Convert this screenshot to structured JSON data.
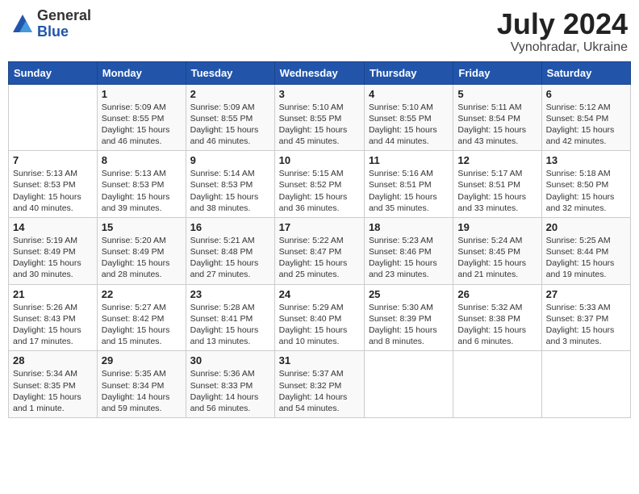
{
  "header": {
    "logo_general": "General",
    "logo_blue": "Blue",
    "month_year": "July 2024",
    "location": "Vynohradar, Ukraine"
  },
  "weekdays": [
    "Sunday",
    "Monday",
    "Tuesday",
    "Wednesday",
    "Thursday",
    "Friday",
    "Saturday"
  ],
  "weeks": [
    [
      {
        "day": "",
        "info": ""
      },
      {
        "day": "1",
        "info": "Sunrise: 5:09 AM\nSunset: 8:55 PM\nDaylight: 15 hours\nand 46 minutes."
      },
      {
        "day": "2",
        "info": "Sunrise: 5:09 AM\nSunset: 8:55 PM\nDaylight: 15 hours\nand 46 minutes."
      },
      {
        "day": "3",
        "info": "Sunrise: 5:10 AM\nSunset: 8:55 PM\nDaylight: 15 hours\nand 45 minutes."
      },
      {
        "day": "4",
        "info": "Sunrise: 5:10 AM\nSunset: 8:55 PM\nDaylight: 15 hours\nand 44 minutes."
      },
      {
        "day": "5",
        "info": "Sunrise: 5:11 AM\nSunset: 8:54 PM\nDaylight: 15 hours\nand 43 minutes."
      },
      {
        "day": "6",
        "info": "Sunrise: 5:12 AM\nSunset: 8:54 PM\nDaylight: 15 hours\nand 42 minutes."
      }
    ],
    [
      {
        "day": "7",
        "info": "Sunrise: 5:13 AM\nSunset: 8:53 PM\nDaylight: 15 hours\nand 40 minutes."
      },
      {
        "day": "8",
        "info": "Sunrise: 5:13 AM\nSunset: 8:53 PM\nDaylight: 15 hours\nand 39 minutes."
      },
      {
        "day": "9",
        "info": "Sunrise: 5:14 AM\nSunset: 8:53 PM\nDaylight: 15 hours\nand 38 minutes."
      },
      {
        "day": "10",
        "info": "Sunrise: 5:15 AM\nSunset: 8:52 PM\nDaylight: 15 hours\nand 36 minutes."
      },
      {
        "day": "11",
        "info": "Sunrise: 5:16 AM\nSunset: 8:51 PM\nDaylight: 15 hours\nand 35 minutes."
      },
      {
        "day": "12",
        "info": "Sunrise: 5:17 AM\nSunset: 8:51 PM\nDaylight: 15 hours\nand 33 minutes."
      },
      {
        "day": "13",
        "info": "Sunrise: 5:18 AM\nSunset: 8:50 PM\nDaylight: 15 hours\nand 32 minutes."
      }
    ],
    [
      {
        "day": "14",
        "info": "Sunrise: 5:19 AM\nSunset: 8:49 PM\nDaylight: 15 hours\nand 30 minutes."
      },
      {
        "day": "15",
        "info": "Sunrise: 5:20 AM\nSunset: 8:49 PM\nDaylight: 15 hours\nand 28 minutes."
      },
      {
        "day": "16",
        "info": "Sunrise: 5:21 AM\nSunset: 8:48 PM\nDaylight: 15 hours\nand 27 minutes."
      },
      {
        "day": "17",
        "info": "Sunrise: 5:22 AM\nSunset: 8:47 PM\nDaylight: 15 hours\nand 25 minutes."
      },
      {
        "day": "18",
        "info": "Sunrise: 5:23 AM\nSunset: 8:46 PM\nDaylight: 15 hours\nand 23 minutes."
      },
      {
        "day": "19",
        "info": "Sunrise: 5:24 AM\nSunset: 8:45 PM\nDaylight: 15 hours\nand 21 minutes."
      },
      {
        "day": "20",
        "info": "Sunrise: 5:25 AM\nSunset: 8:44 PM\nDaylight: 15 hours\nand 19 minutes."
      }
    ],
    [
      {
        "day": "21",
        "info": "Sunrise: 5:26 AM\nSunset: 8:43 PM\nDaylight: 15 hours\nand 17 minutes."
      },
      {
        "day": "22",
        "info": "Sunrise: 5:27 AM\nSunset: 8:42 PM\nDaylight: 15 hours\nand 15 minutes."
      },
      {
        "day": "23",
        "info": "Sunrise: 5:28 AM\nSunset: 8:41 PM\nDaylight: 15 hours\nand 13 minutes."
      },
      {
        "day": "24",
        "info": "Sunrise: 5:29 AM\nSunset: 8:40 PM\nDaylight: 15 hours\nand 10 minutes."
      },
      {
        "day": "25",
        "info": "Sunrise: 5:30 AM\nSunset: 8:39 PM\nDaylight: 15 hours\nand 8 minutes."
      },
      {
        "day": "26",
        "info": "Sunrise: 5:32 AM\nSunset: 8:38 PM\nDaylight: 15 hours\nand 6 minutes."
      },
      {
        "day": "27",
        "info": "Sunrise: 5:33 AM\nSunset: 8:37 PM\nDaylight: 15 hours\nand 3 minutes."
      }
    ],
    [
      {
        "day": "28",
        "info": "Sunrise: 5:34 AM\nSunset: 8:35 PM\nDaylight: 15 hours\nand 1 minute."
      },
      {
        "day": "29",
        "info": "Sunrise: 5:35 AM\nSunset: 8:34 PM\nDaylight: 14 hours\nand 59 minutes."
      },
      {
        "day": "30",
        "info": "Sunrise: 5:36 AM\nSunset: 8:33 PM\nDaylight: 14 hours\nand 56 minutes."
      },
      {
        "day": "31",
        "info": "Sunrise: 5:37 AM\nSunset: 8:32 PM\nDaylight: 14 hours\nand 54 minutes."
      },
      {
        "day": "",
        "info": ""
      },
      {
        "day": "",
        "info": ""
      },
      {
        "day": "",
        "info": ""
      }
    ]
  ]
}
